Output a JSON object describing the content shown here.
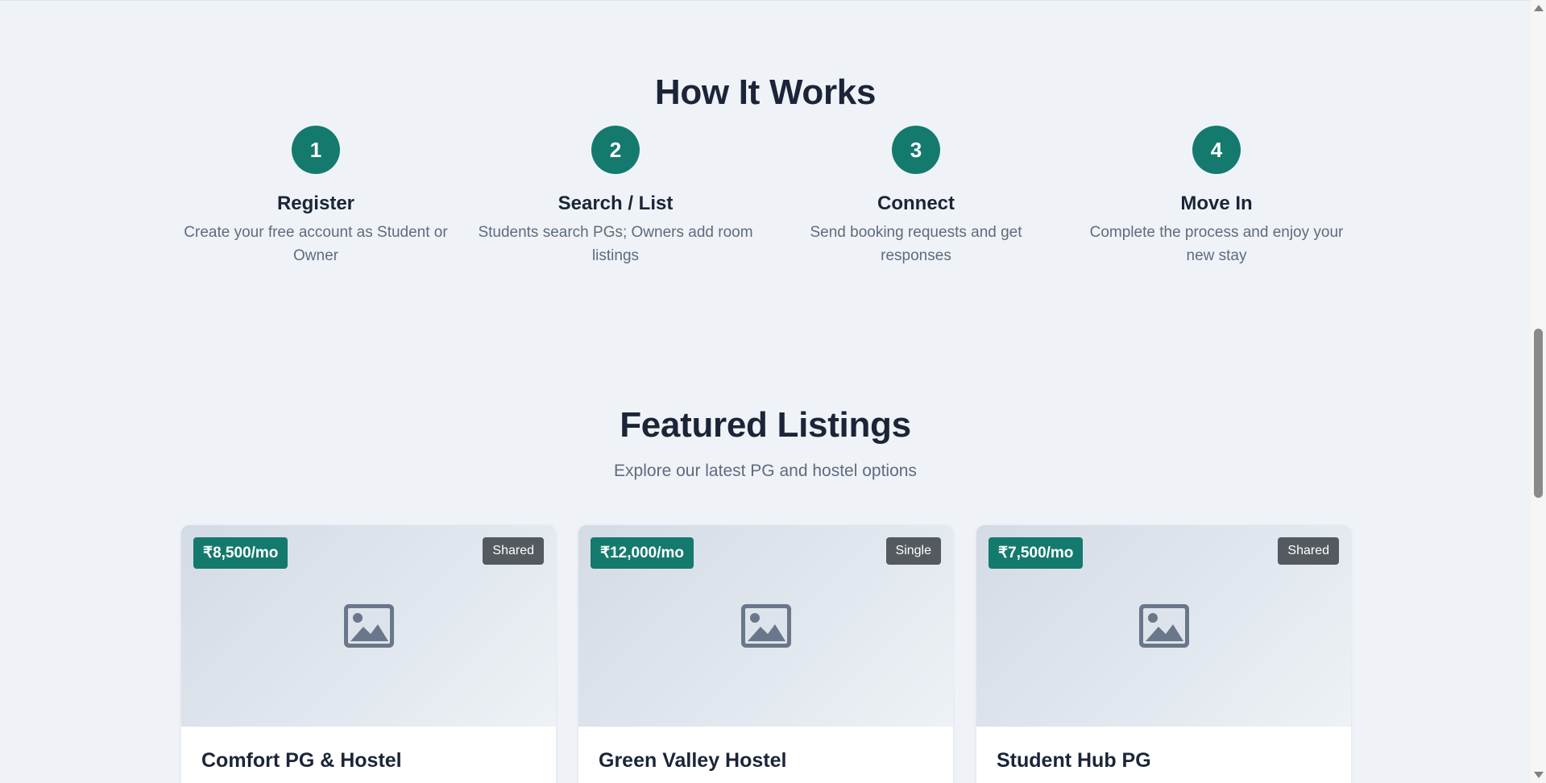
{
  "how_it_works": {
    "title": "How It Works",
    "steps": [
      {
        "number": "1",
        "title": "Register",
        "description": "Create your free account as Student or Owner"
      },
      {
        "number": "2",
        "title": "Search / List",
        "description": "Students search PGs; Owners add room listings"
      },
      {
        "number": "3",
        "title": "Connect",
        "description": "Send booking requests and get responses"
      },
      {
        "number": "4",
        "title": "Move In",
        "description": "Complete the process and enjoy your new stay"
      }
    ]
  },
  "featured": {
    "title": "Featured Listings",
    "subtitle": "Explore our latest PG and hostel options",
    "listings": [
      {
        "price": "₹8,500/mo",
        "room_type": "Shared",
        "name": "Comfort PG & Hostel",
        "icon": "image-placeholder-icon"
      },
      {
        "price": "₹12,000/mo",
        "room_type": "Single",
        "name": "Green Valley Hostel",
        "icon": "image-placeholder-icon"
      },
      {
        "price": "₹7,500/mo",
        "room_type": "Shared",
        "name": "Student Hub PG",
        "icon": "image-placeholder-icon"
      }
    ]
  },
  "colors": {
    "accent": "#147a6d",
    "background": "#eff3f8",
    "heading": "#1b2537",
    "muted_text": "#5f6b7c",
    "type_badge": "#555a60"
  }
}
